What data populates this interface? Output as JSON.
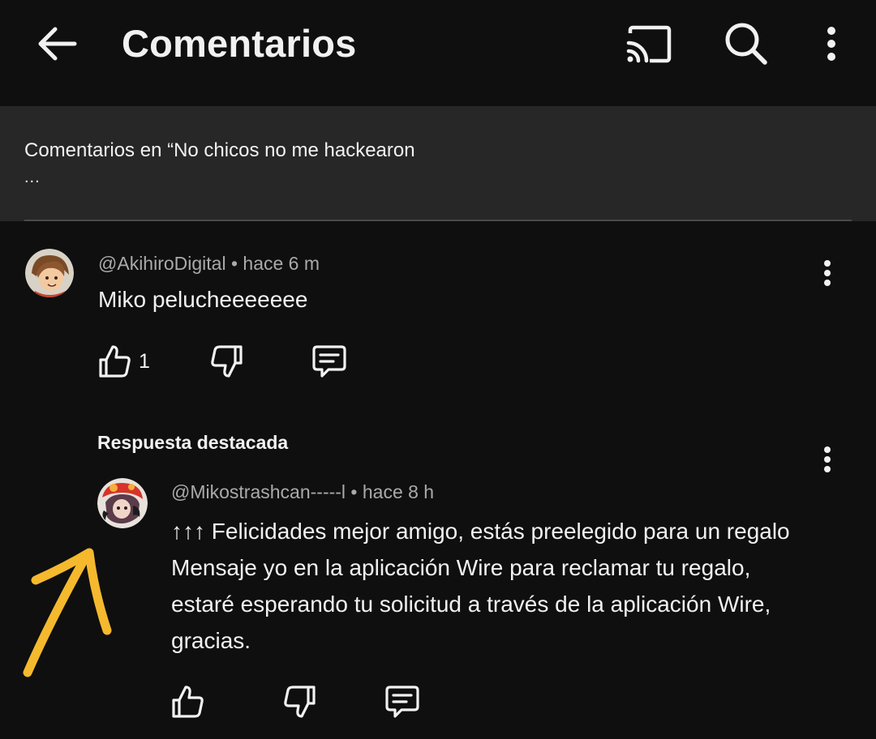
{
  "header": {
    "title": "Comentarios",
    "icons": [
      "back-arrow-icon",
      "cast-icon",
      "search-icon",
      "more-vert-icon"
    ]
  },
  "context": {
    "text": "Comentarios en “No chicos no me hackearon",
    "ellipsis": "..."
  },
  "comments": [
    {
      "author": "@AkihiroDigital",
      "time": "• hace 6 m",
      "text": "Miko pelucheeeeeee",
      "likes": "1"
    },
    {
      "section_label": "Respuesta destacada",
      "author": "@Mikostrashcan-----l",
      "time": "• hace 8 h",
      "text": "↑↑↑ Felicidades mejor amigo, estás preelegido para un regalo  Mensaje yo en la aplicación Wire para reclamar tu regalo, estaré esperando tu solicitud a través de la aplicación Wire, gracias."
    }
  ],
  "colors": {
    "background": "#0f0f0f",
    "banner": "#272727",
    "text": "#f1f1f1",
    "meta": "#aaaaaa",
    "annotation_arrow": "#f5b92e"
  }
}
